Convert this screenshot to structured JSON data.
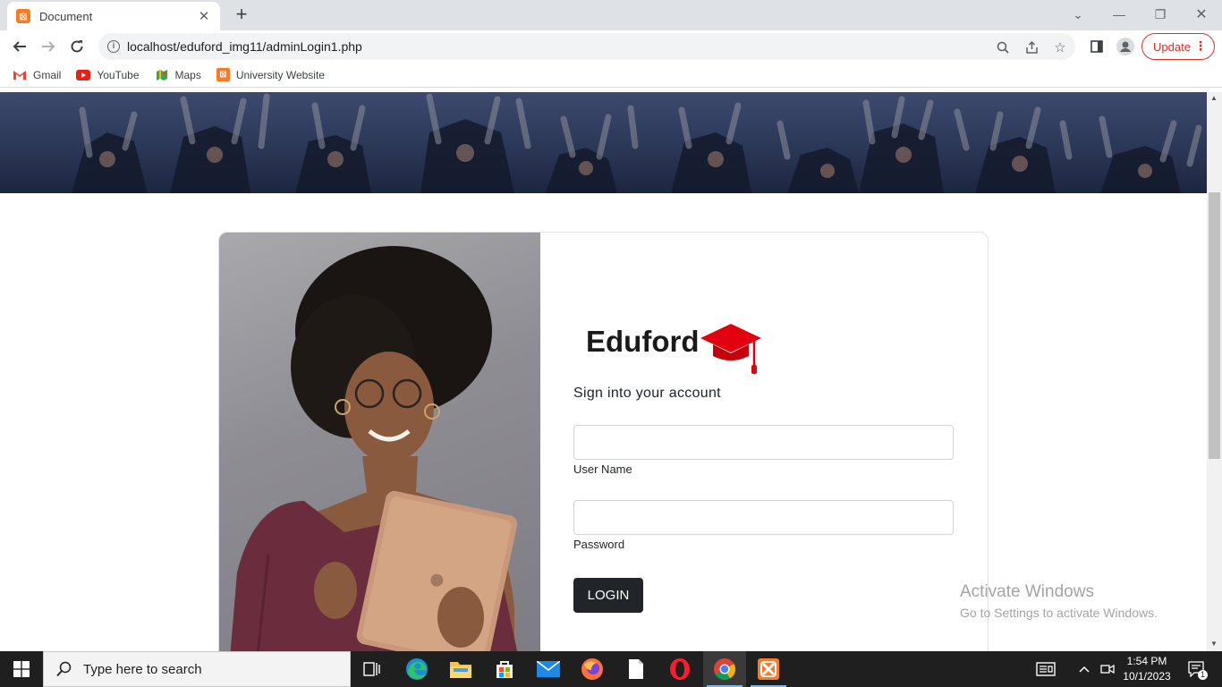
{
  "browser": {
    "tab_title": "Document",
    "tab_favicon": "xampp-icon",
    "new_tab_symbol": "+",
    "url": "localhost/eduford_img11/adminLogin1.php",
    "update_label": "Update",
    "bookmarks": [
      {
        "label": "Gmail",
        "icon": "gmail-icon"
      },
      {
        "label": "YouTube",
        "icon": "youtube-icon"
      },
      {
        "label": "Maps",
        "icon": "maps-icon"
      },
      {
        "label": "University Website",
        "icon": "xampp-icon"
      }
    ]
  },
  "page": {
    "brand": "Eduford",
    "sign_in_heading": "Sign into your account",
    "username_label": "User Name",
    "username_value": "",
    "password_label": "Password",
    "password_value": "",
    "login_label": "LOGIN"
  },
  "watermark": {
    "title": "Activate Windows",
    "subtitle": "Go to Settings to activate Windows."
  },
  "taskbar": {
    "search_placeholder": "Type here to search",
    "time": "1:54 PM",
    "date": "10/1/2023",
    "notification_count": "1"
  },
  "colors": {
    "accent_red": "#e3000f",
    "button_dark": "#212529",
    "hero_overlay": "#2b3756"
  }
}
